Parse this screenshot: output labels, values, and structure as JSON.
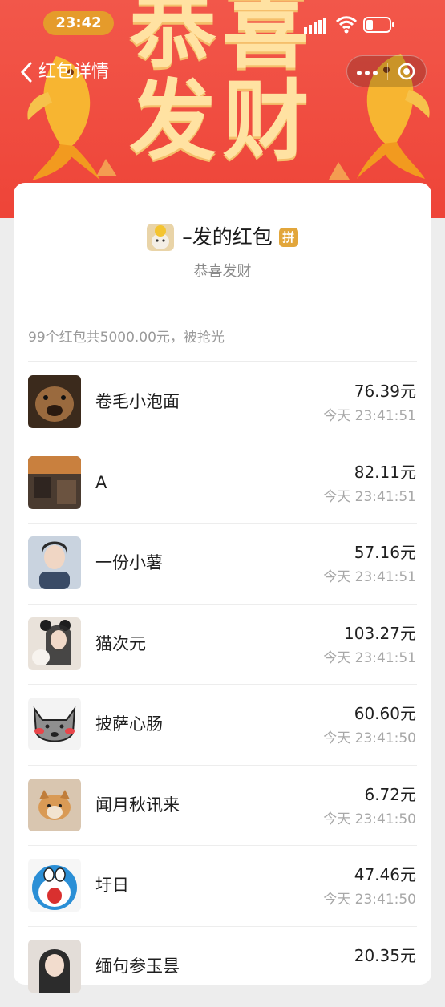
{
  "status_bar": {
    "time": "23:42",
    "time_badge_color": "#e59b2b",
    "icons": [
      "signal-icon",
      "wifi-icon",
      "battery-icon"
    ]
  },
  "banner": {
    "line1": "恭喜",
    "line2": "发财",
    "background": "#f0493d",
    "text_color": "#ffe2a2"
  },
  "nav": {
    "back_icon": "chevron-left-icon",
    "title": "红包详情",
    "more_icon": "ellipsis-icon",
    "close_icon": "target-icon"
  },
  "packet": {
    "sender": "–发的红包",
    "badge": "拼",
    "greeting": "恭喜发财",
    "summary": "99个红包共5000.00元，被抢光"
  },
  "records": [
    {
      "name": "卷毛小泡面",
      "amount": "76.39元",
      "time": "今天 23:41:51",
      "avatar": "dog-photo"
    },
    {
      "name": "A",
      "amount": "82.11元",
      "time": "今天 23:41:51",
      "avatar": "room-photo"
    },
    {
      "name": "一份小薯",
      "amount": "57.16元",
      "time": "今天 23:41:51",
      "avatar": "person-photo"
    },
    {
      "name": "猫次元",
      "amount": "103.27元",
      "time": "今天 23:41:51",
      "avatar": "girl-with-cat-photo"
    },
    {
      "name": "披萨心肠",
      "amount": "60.60元",
      "time": "今天 23:41:50",
      "avatar": "cartoon-cat"
    },
    {
      "name": "闻月秋讯来",
      "amount": "6.72元",
      "time": "今天 23:41:50",
      "avatar": "shiba-photo"
    },
    {
      "name": "圩日",
      "amount": "47.46元",
      "time": "今天 23:41:50",
      "avatar": "doraemon-cartoon"
    },
    {
      "name": "缅句参玉昙",
      "amount": "20.35元",
      "time": "",
      "avatar": "person-photo-2"
    }
  ]
}
